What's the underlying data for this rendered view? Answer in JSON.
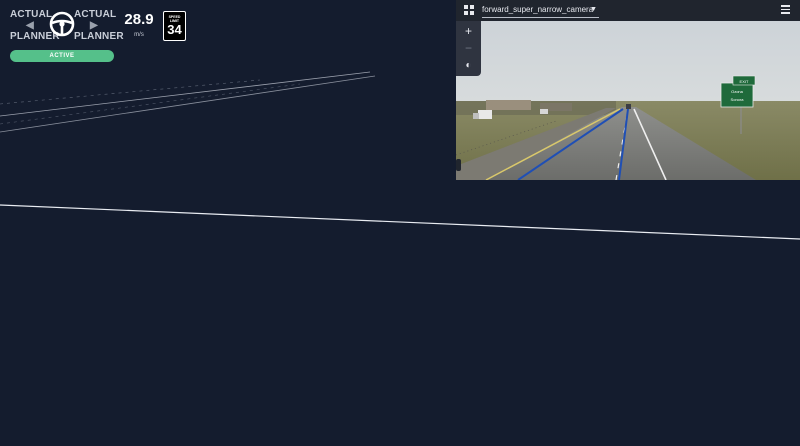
{
  "hud": {
    "left_signal": {
      "label_top": "ACTUAL",
      "label_bottom": "PLANNER",
      "icon": "arrow-left-icon"
    },
    "right_signal": {
      "label_top": "ACTUAL",
      "label_bottom": "PLANNER",
      "icon": "arrow-right-icon"
    },
    "steering_icon": "steering-wheel-icon",
    "speed": {
      "value": "28.9",
      "unit": "m/s"
    },
    "speed_limit": {
      "label": "SPEED LIMIT",
      "value": "34"
    },
    "status": {
      "label": "ACTIVE",
      "color": "#55c08a"
    }
  },
  "camera": {
    "selected": "forward_super_narrow_camera",
    "layout_icon": "grid-icon",
    "menu_icon": "hamburger-menu-icon",
    "controls": [
      {
        "name": "zoom-in",
        "glyph": "+"
      },
      {
        "name": "zoom-out",
        "glyph": "−"
      },
      {
        "name": "contrast",
        "glyph": "◐"
      }
    ],
    "overlay_sign": {
      "line1": "EXIT",
      "line2": "Ozona",
      "line3": "Sonora"
    }
  },
  "colors": {
    "background": "#141c2e",
    "lane_line": "#ffffff",
    "planner_line": "#1f4fb5"
  }
}
